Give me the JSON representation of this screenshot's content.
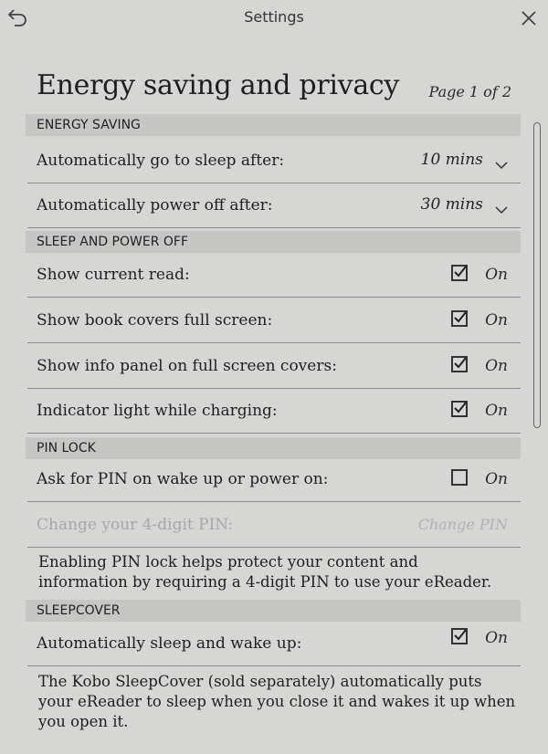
{
  "header": {
    "title": "Settings"
  },
  "page": {
    "title": "Energy saving and privacy",
    "indicator": "Page 1 of 2"
  },
  "sections": {
    "energy": {
      "title": "ENERGY SAVING",
      "rows": [
        {
          "label": "Automatically go to sleep after:",
          "value": "10 mins"
        },
        {
          "label": "Automatically power off after:",
          "value": "30 mins"
        }
      ]
    },
    "sleep": {
      "title": "SLEEP AND POWER OFF",
      "rows": [
        {
          "label": "Show current read:",
          "state": "On",
          "checked": true
        },
        {
          "label": "Show book covers full screen:",
          "state": "On",
          "checked": true
        },
        {
          "label": "Show info panel on full screen covers:",
          "state": "On",
          "checked": true
        },
        {
          "label": "Indicator light while charging:",
          "state": "On",
          "checked": true
        }
      ]
    },
    "pin": {
      "title": "PIN LOCK",
      "ask": {
        "label": "Ask for PIN on wake up or power on:",
        "state": "On",
        "checked": false
      },
      "change": {
        "label": "Change your 4-digit PIN:",
        "button": "Change PIN"
      },
      "description_1": "Enabling PIN lock helps protect your content and",
      "description_2": "information by requiring a 4-digit PIN to use your eReader."
    },
    "sleepcover": {
      "title": "SLEEPCOVER",
      "row": {
        "label": "Automatically sleep and wake up:",
        "state": "On",
        "checked": true
      },
      "description_1": "The Kobo SleepCover (sold separately) automatically puts",
      "description_2": "your eReader to sleep when you close it and wakes it up when",
      "description_3": "you open it."
    }
  }
}
